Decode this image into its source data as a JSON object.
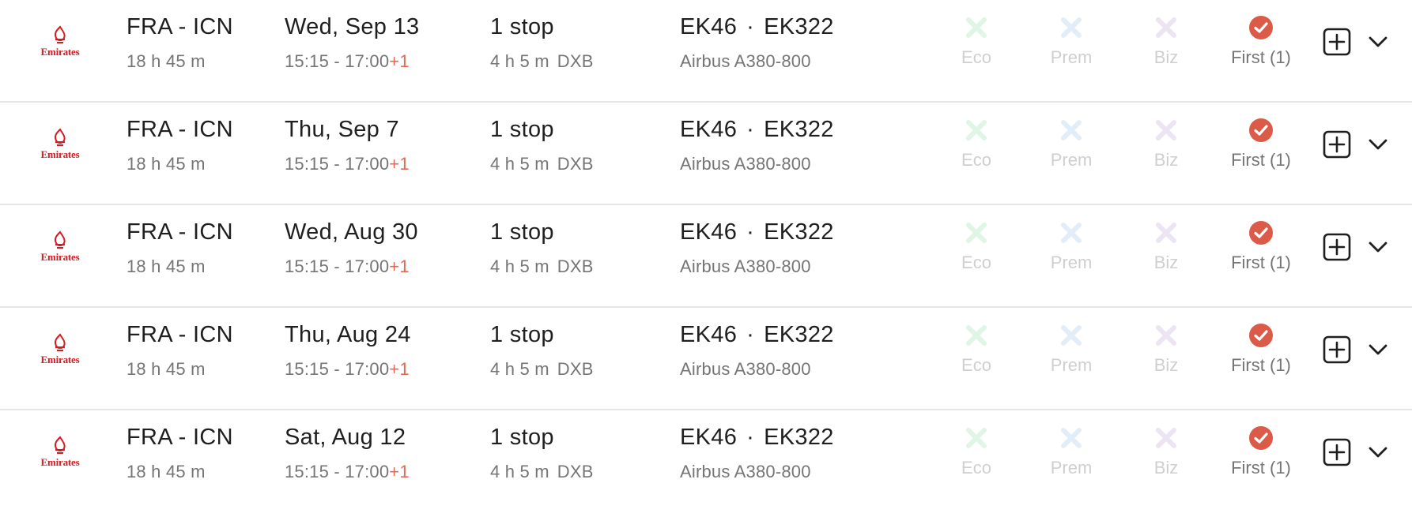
{
  "colors": {
    "eco": "#dff5e5",
    "prem": "#e1edf8",
    "biz": "#ece4f3",
    "first": "#dc5a48",
    "plus_day": "#e06b55",
    "airline_red": "#d71921",
    "divider": "#e6e6e6"
  },
  "flights": [
    {
      "airline_logo_text": "Emirates",
      "route": "FRA - ICN",
      "duration": "18 h 45 m",
      "date": "Wed, Sep 13",
      "times": "15:15 - 17:00",
      "plus_day": "+1",
      "stops": "1 stop",
      "stop_duration": "4 h 5 m",
      "stop_airport": "DXB",
      "flight_1": "EK46",
      "flight_sep": "·",
      "flight_2": "EK322",
      "aircraft": "Airbus A380-800",
      "cabins": {
        "eco": "Eco",
        "prem": "Prem",
        "biz": "Biz",
        "first": "First (1)"
      },
      "cabin_icons": {
        "eco": "x-icon",
        "prem": "x-icon",
        "biz": "x-icon",
        "first": "check-circle-icon"
      }
    },
    {
      "airline_logo_text": "Emirates",
      "route": "FRA - ICN",
      "duration": "18 h 45 m",
      "date": "Thu, Sep 7",
      "times": "15:15 - 17:00",
      "plus_day": "+1",
      "stops": "1 stop",
      "stop_duration": "4 h 5 m",
      "stop_airport": "DXB",
      "flight_1": "EK46",
      "flight_sep": "·",
      "flight_2": "EK322",
      "aircraft": "Airbus A380-800",
      "cabins": {
        "eco": "Eco",
        "prem": "Prem",
        "biz": "Biz",
        "first": "First (1)"
      },
      "cabin_icons": {
        "eco": "x-icon",
        "prem": "x-icon",
        "biz": "x-icon",
        "first": "check-circle-icon"
      }
    },
    {
      "airline_logo_text": "Emirates",
      "route": "FRA - ICN",
      "duration": "18 h 45 m",
      "date": "Wed, Aug 30",
      "times": "15:15 - 17:00",
      "plus_day": "+1",
      "stops": "1 stop",
      "stop_duration": "4 h 5 m",
      "stop_airport": "DXB",
      "flight_1": "EK46",
      "flight_sep": "·",
      "flight_2": "EK322",
      "aircraft": "Airbus A380-800",
      "cabins": {
        "eco": "Eco",
        "prem": "Prem",
        "biz": "Biz",
        "first": "First (1)"
      },
      "cabin_icons": {
        "eco": "x-icon",
        "prem": "x-icon",
        "biz": "x-icon",
        "first": "check-circle-icon"
      }
    },
    {
      "airline_logo_text": "Emirates",
      "route": "FRA - ICN",
      "duration": "18 h 45 m",
      "date": "Thu, Aug 24",
      "times": "15:15 - 17:00",
      "plus_day": "+1",
      "stops": "1 stop",
      "stop_duration": "4 h 5 m",
      "stop_airport": "DXB",
      "flight_1": "EK46",
      "flight_sep": "·",
      "flight_2": "EK322",
      "aircraft": "Airbus A380-800",
      "cabins": {
        "eco": "Eco",
        "prem": "Prem",
        "biz": "Biz",
        "first": "First (1)"
      },
      "cabin_icons": {
        "eco": "x-icon",
        "prem": "x-icon",
        "biz": "x-icon",
        "first": "check-circle-icon"
      }
    },
    {
      "airline_logo_text": "Emirates",
      "route": "FRA - ICN",
      "duration": "18 h 45 m",
      "date": "Sat, Aug 12",
      "times": "15:15 - 17:00",
      "plus_day": "+1",
      "stops": "1 stop",
      "stop_duration": "4 h 5 m",
      "stop_airport": "DXB",
      "flight_1": "EK46",
      "flight_sep": "·",
      "flight_2": "EK322",
      "aircraft": "Airbus A380-800",
      "cabins": {
        "eco": "Eco",
        "prem": "Prem",
        "biz": "Biz",
        "first": "First (1)"
      },
      "cabin_icons": {
        "eco": "x-icon",
        "prem": "x-icon",
        "biz": "x-icon",
        "first": "check-circle-icon"
      }
    }
  ]
}
